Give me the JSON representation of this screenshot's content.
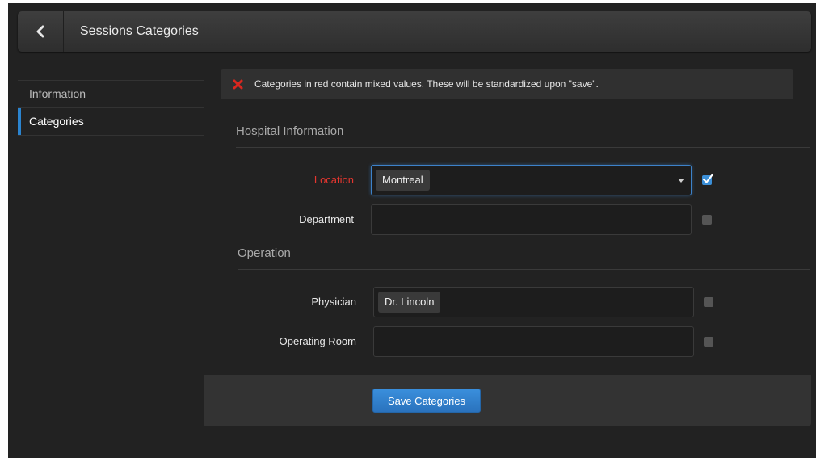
{
  "header": {
    "title": "Sessions Categories",
    "back_icon": "chevron-left-icon"
  },
  "sidebar": {
    "items": [
      {
        "label": "Information",
        "active": false
      },
      {
        "label": "Categories",
        "active": true
      }
    ]
  },
  "alert": {
    "icon": "red-x-icon",
    "text": "Categories in red contain mixed values. These will be standardized upon \"save\"."
  },
  "sections": [
    {
      "title": "Hospital Information",
      "fields": [
        {
          "label": "Location",
          "value": "Montreal",
          "mixed_values": true,
          "checked": true
        },
        {
          "label": "Department",
          "value": "",
          "checked": false
        }
      ]
    },
    {
      "title": "Operation",
      "fields": [
        {
          "label": "Physician",
          "value": "Dr. Lincoln",
          "checked": false
        },
        {
          "label": "Operating Room",
          "value": "",
          "checked": false
        }
      ]
    }
  ],
  "footer": {
    "save_label": "Save Categories"
  },
  "colors": {
    "accent": "#2b84cf",
    "error": "#e5362f",
    "background": "#222222"
  }
}
